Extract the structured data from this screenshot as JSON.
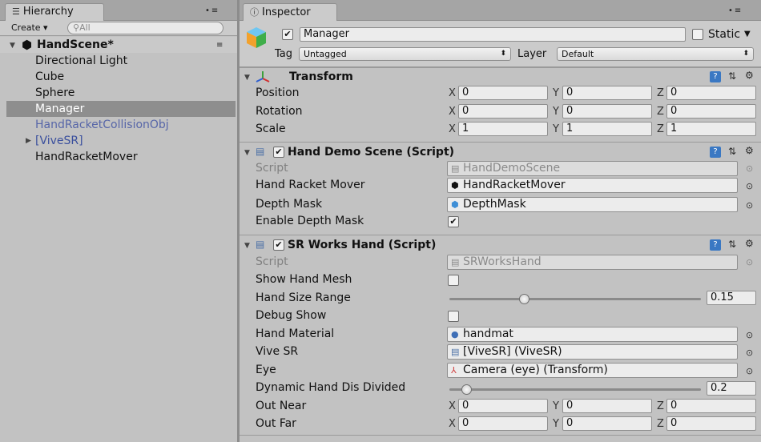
{
  "hierarchy": {
    "tab_label": "Hierarchy",
    "panel_controls": "•≡",
    "create_label": "Create ▾",
    "search_placeholder": "All",
    "scene_name": "HandScene*",
    "items": [
      {
        "label": "Directional Light",
        "style": "normal"
      },
      {
        "label": "Cube",
        "style": "normal"
      },
      {
        "label": "Sphere",
        "style": "normal"
      },
      {
        "label": "Manager",
        "style": "selected"
      },
      {
        "label": "HandRacketCollisionObj",
        "style": "prefab-soft"
      },
      {
        "label": "[ViveSR]",
        "style": "prefab",
        "expandable": true
      },
      {
        "label": "HandRacketMover",
        "style": "normal"
      }
    ]
  },
  "inspector": {
    "tab_label": "Inspector",
    "object_name": "Manager",
    "object_active": true,
    "static_label": "Static",
    "static_checked": false,
    "tag_label": "Tag",
    "tag_value": "Untagged",
    "layer_label": "Layer",
    "layer_value": "Default",
    "transform": {
      "title": "Transform",
      "position_label": "Position",
      "rotation_label": "Rotation",
      "scale_label": "Scale",
      "position": {
        "x": "0",
        "y": "0",
        "z": "0"
      },
      "rotation": {
        "x": "0",
        "y": "0",
        "z": "0"
      },
      "scale": {
        "x": "1",
        "y": "1",
        "z": "1"
      }
    },
    "hand_demo": {
      "title": "Hand Demo Scene (Script)",
      "script_label": "Script",
      "script_value": "HandDemoScene",
      "hand_racket_mover_label": "Hand Racket Mover",
      "hand_racket_mover_value": "HandRacketMover",
      "depth_mask_label": "Depth Mask",
      "depth_mask_value": "DepthMask",
      "enable_depth_mask_label": "Enable Depth Mask",
      "enable_depth_mask": true
    },
    "srworks_hand": {
      "title": "SR Works Hand (Script)",
      "script_label": "Script",
      "script_value": "SRWorksHand",
      "show_hand_mesh_label": "Show Hand Mesh",
      "show_hand_mesh": false,
      "hand_size_range_label": "Hand Size Range",
      "hand_size_range_value": "0.15",
      "hand_size_range_fraction": 0.29,
      "debug_show_label": "Debug Show",
      "debug_show": false,
      "hand_material_label": "Hand Material",
      "hand_material_value": "handmat",
      "vive_sr_label": "Vive SR",
      "vive_sr_value": "[ViveSR] (ViveSR)",
      "eye_label": "Eye",
      "eye_value": "Camera (eye) (Transform)",
      "dynamic_label": "Dynamic Hand Dis Divided",
      "dynamic_value": "0.2",
      "dynamic_fraction": 0.05,
      "out_near_label": "Out Near",
      "out_near": {
        "x": "0",
        "y": "0",
        "z": "0"
      },
      "out_far_label": "Out Far",
      "out_far": {
        "x": "0",
        "y": "0",
        "z": "0"
      }
    },
    "axis_labels": {
      "x": "X",
      "y": "Y",
      "z": "Z"
    }
  }
}
